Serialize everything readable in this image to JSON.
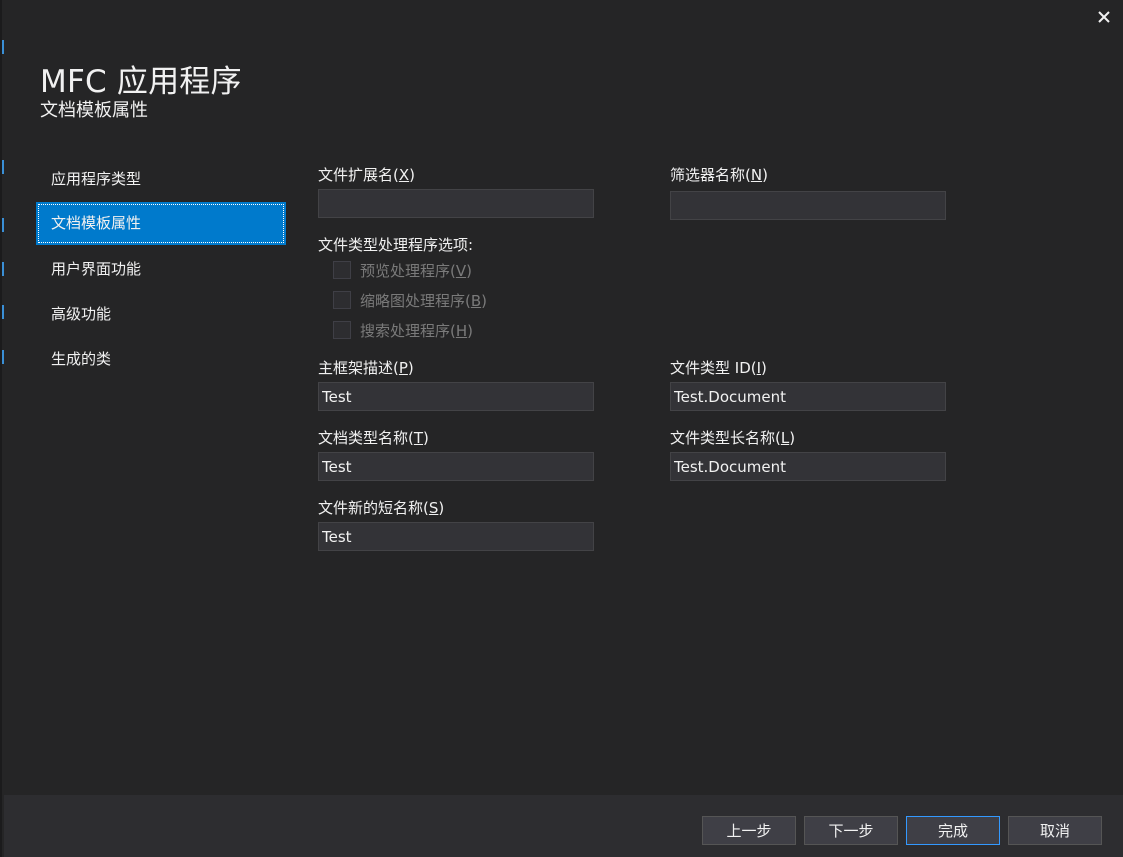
{
  "window": {
    "title": "MFC 应用程序",
    "subtitle": "文档模板属性",
    "close_icon": "close-icon"
  },
  "nav": {
    "items": [
      {
        "label": "应用程序类型",
        "selected": false
      },
      {
        "label": "文档模板属性",
        "selected": true
      },
      {
        "label": "用户界面功能",
        "selected": false
      },
      {
        "label": "高级功能",
        "selected": false
      },
      {
        "label": "生成的类",
        "selected": false
      }
    ]
  },
  "form": {
    "file_extension": {
      "label": "文件扩展名(",
      "mnemonic": "X",
      "value": ""
    },
    "filter_name": {
      "label": "筛选器名称(",
      "mnemonic": "N",
      "value": ""
    },
    "handler_options": {
      "label": "文件类型处理程序选项:",
      "options": [
        {
          "label": "预览处理程序(",
          "mnemonic": "V",
          "checked": false,
          "enabled": false
        },
        {
          "label": "缩略图处理程序(",
          "mnemonic": "B",
          "checked": false,
          "enabled": false
        },
        {
          "label": "搜索处理程序(",
          "mnemonic": "H",
          "checked": false,
          "enabled": false
        }
      ]
    },
    "main_frame_caption": {
      "label": "主框架描述(",
      "mnemonic": "P",
      "value": "Test"
    },
    "file_type_id": {
      "label": "文件类型 ID(",
      "mnemonic": "I",
      "value": "Test.Document"
    },
    "doc_type_name": {
      "label": "文档类型名称(",
      "mnemonic": "T",
      "value": "Test"
    },
    "file_type_long_name": {
      "label": "文件类型长名称(",
      "mnemonic": "L",
      "value": "Test.Document"
    },
    "file_new_short_name": {
      "label": "文件新的短名称(",
      "mnemonic": "S",
      "value": "Test"
    }
  },
  "footer": {
    "prev_label": "上一步",
    "next_label": "下一步",
    "finish_label": "完成",
    "cancel_label": "取消"
  },
  "colors": {
    "background": "#252526",
    "footer_background": "#2d2d30",
    "accent": "#007acc",
    "input_background": "#333337",
    "text": "#f1f1f1",
    "disabled_text": "#7a7a7a"
  }
}
